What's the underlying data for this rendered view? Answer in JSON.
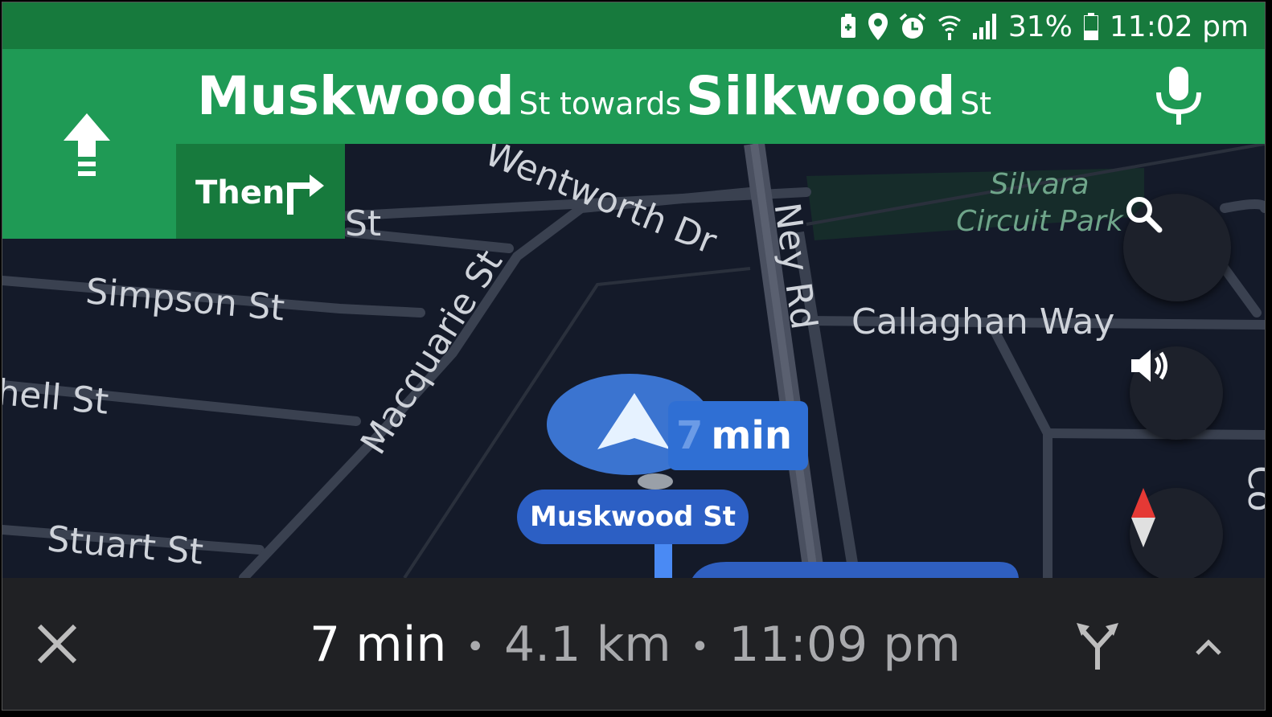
{
  "status_bar": {
    "icons": [
      "battery-saver-icon",
      "location-pin-icon",
      "alarm-icon",
      "wifi-icon",
      "signal-icon"
    ],
    "battery_percent": "31%",
    "time": "11:02 pm"
  },
  "header": {
    "maneuver_icon": "straight-arrow-icon",
    "street_name": "Muskwood",
    "street_suffix": "St",
    "towards_word": "towards",
    "towards_name": "Silkwood",
    "towards_suffix": "St",
    "mic_icon": "microphone-icon",
    "then_label": "Then",
    "then_icon": "turn-right-icon"
  },
  "map": {
    "roads": {
      "wentworth": "Wentworth Dr",
      "simpson": "Simpson St",
      "mitchell": "hell St",
      "stuart": "Stuart St",
      "macquarie": "Macquarie St",
      "ney": "Ney Rd",
      "callaghan": "Callaghan Way",
      "partial_st": "St",
      "partial_right": "Co"
    },
    "park_line1": "Silvara",
    "park_line2": "Circuit Park",
    "eta_faded": "7",
    "eta_unit": "min",
    "current_street": "Muskwood St",
    "colors": {
      "route": "#4a8af4",
      "puck": "#3b74d0",
      "road": "#3a4150",
      "background": "#141a29"
    }
  },
  "controls": {
    "search_icon": "search-icon",
    "sound_icon": "volume-icon",
    "compass_icon": "compass-icon"
  },
  "bottom_bar": {
    "close_icon": "close-icon",
    "duration": "7 min",
    "separator": "•",
    "distance": "4.1 km",
    "arrival": "11:09 pm",
    "alt_routes_icon": "alternate-routes-icon",
    "expand_icon": "chevron-up-icon"
  }
}
